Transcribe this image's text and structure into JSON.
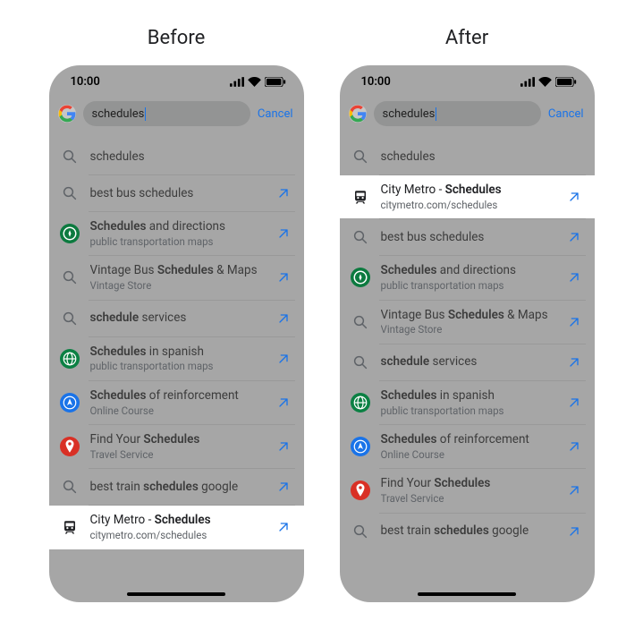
{
  "labels": {
    "before": "Before",
    "after": "After"
  },
  "statusbar": {
    "time": "10:00"
  },
  "search": {
    "query": "schedules",
    "cancel": "Cancel"
  },
  "rows": {
    "schedules": {
      "title_parts": [
        {
          "t": "schedules",
          "b": false
        }
      ],
      "icon": "magnifier",
      "arrow": false
    },
    "cityMetro": {
      "title_parts": [
        {
          "t": "City Metro -  ",
          "b": false
        },
        {
          "t": "Schedules",
          "b": true
        }
      ],
      "subtitle": "citymetro.com/schedules",
      "icon": "train",
      "arrow": true
    },
    "bestBus": {
      "title_parts": [
        {
          "t": "best bus schedules",
          "b": false
        }
      ],
      "icon": "magnifier",
      "arrow": true
    },
    "schedulesDirections": {
      "title_parts": [
        {
          "t": "Schedules",
          "b": true
        },
        {
          "t": " and directions",
          "b": false
        }
      ],
      "subtitle": "public transportation maps",
      "icon": "compass",
      "arrow": true
    },
    "vintageBus": {
      "title_parts": [
        {
          "t": "Vintage Bus ",
          "b": false
        },
        {
          "t": "Schedules",
          "b": true
        },
        {
          "t": " & Maps",
          "b": false
        }
      ],
      "subtitle": "Vintage Store",
      "icon": "magnifier",
      "arrow": true
    },
    "scheduleServices": {
      "title_parts": [
        {
          "t": "schedule",
          "b": true
        },
        {
          "t": " services",
          "b": false
        }
      ],
      "icon": "magnifier",
      "arrow": true
    },
    "spanish": {
      "title_parts": [
        {
          "t": "Schedules",
          "b": true
        },
        {
          "t": " in spanish",
          "b": false
        }
      ],
      "subtitle": "public transportation maps",
      "icon": "globe",
      "arrow": true
    },
    "reinforcement": {
      "title_parts": [
        {
          "t": "Schedules",
          "b": true
        },
        {
          "t": " of reinforcement",
          "b": false
        }
      ],
      "subtitle": "Online Course",
      "icon": "nav",
      "arrow": true
    },
    "findYour": {
      "title_parts": [
        {
          "t": "Find Your ",
          "b": false
        },
        {
          "t": "Schedules",
          "b": true
        }
      ],
      "subtitle": "Travel Service",
      "icon": "pin",
      "arrow": true
    },
    "bestTrain": {
      "title_parts": [
        {
          "t": "best train ",
          "b": false
        },
        {
          "t": "schedules",
          "b": true
        },
        {
          "t": " google",
          "b": false
        }
      ],
      "icon": "magnifier",
      "arrow": true
    }
  },
  "phones": {
    "before": {
      "order": [
        "schedules",
        "bestBus",
        "schedulesDirections",
        "vintageBus",
        "scheduleServices",
        "spanish",
        "reinforcement",
        "findYour",
        "bestTrain",
        "cityMetro"
      ],
      "highlight": "cityMetro"
    },
    "after": {
      "order": [
        "schedules",
        "cityMetro",
        "bestBus",
        "schedulesDirections",
        "vintageBus",
        "scheduleServices",
        "spanish",
        "reinforcement",
        "findYour",
        "bestTrain"
      ],
      "highlight": "cityMetro"
    }
  }
}
